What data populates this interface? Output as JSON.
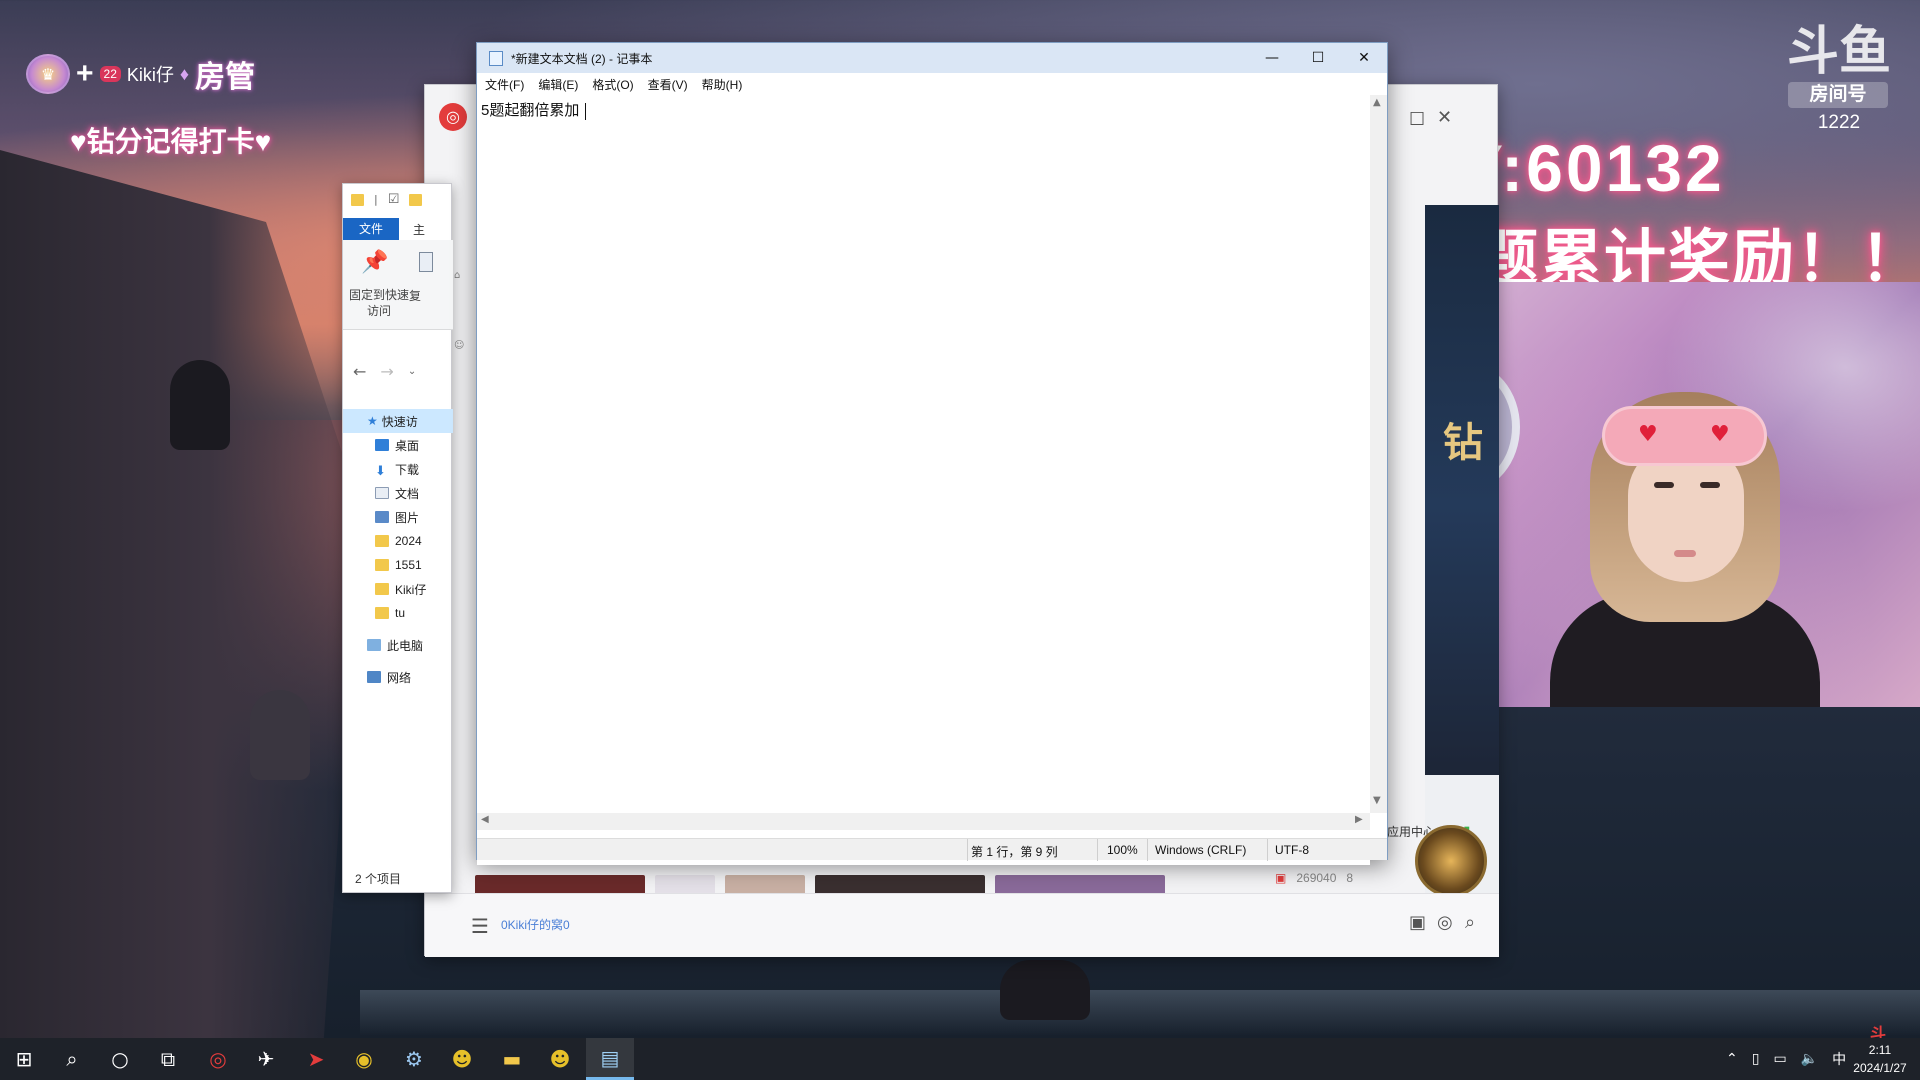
{
  "overlay": {
    "badge_name": "Kiki仔",
    "badge_level": "22",
    "badge_role": "房管",
    "subtitle": "♥钻分记得打卡♥",
    "yy_id": "YY:60132",
    "reward": "答题累计奖励！！",
    "room_label": "房间号",
    "room_number": "1222"
  },
  "notepad": {
    "title": "*新建文本文档 (2) - 记事本",
    "menu": [
      "文件(F)",
      "编辑(E)",
      "格式(O)",
      "查看(V)",
      "帮助(H)"
    ],
    "content": "5题起翻倍累加",
    "status": {
      "position": "第 1 行，第 9 列",
      "zoom": "100%",
      "line_ending": "Windows (CRLF)",
      "encoding": "UTF-8"
    }
  },
  "explorer": {
    "ribbon_tab_file": "文件",
    "ribbon_tab_home": "主",
    "pin_label": "固定到快速访问",
    "copy_label": "复",
    "quick_access": "快速访",
    "tree": [
      {
        "label": "桌面",
        "color": "#2f7fd8"
      },
      {
        "label": "下载",
        "color": "#2f7fd8"
      },
      {
        "label": "文档",
        "color": "#8c9cb4"
      },
      {
        "label": "图片",
        "color": "#5a8ac8"
      },
      {
        "label": "2024",
        "color": "#f2c84b"
      },
      {
        "label": "1551",
        "color": "#f2c84b"
      },
      {
        "label": "Kiki仔",
        "color": "#f2c84b"
      },
      {
        "label": "tu",
        "color": "#f2c84b"
      }
    ],
    "this_pc": "此电脑",
    "network": "网络",
    "status": "2 个项目"
  },
  "music": {
    "now_playing": "0Kiki仔的窝0",
    "app_center": "应用中心",
    "listeners": "269040",
    "count": "8"
  },
  "taskbar": {
    "time": "2:11",
    "date": "2024/1/27",
    "ime": "中",
    "accent": "#76b9ed"
  }
}
